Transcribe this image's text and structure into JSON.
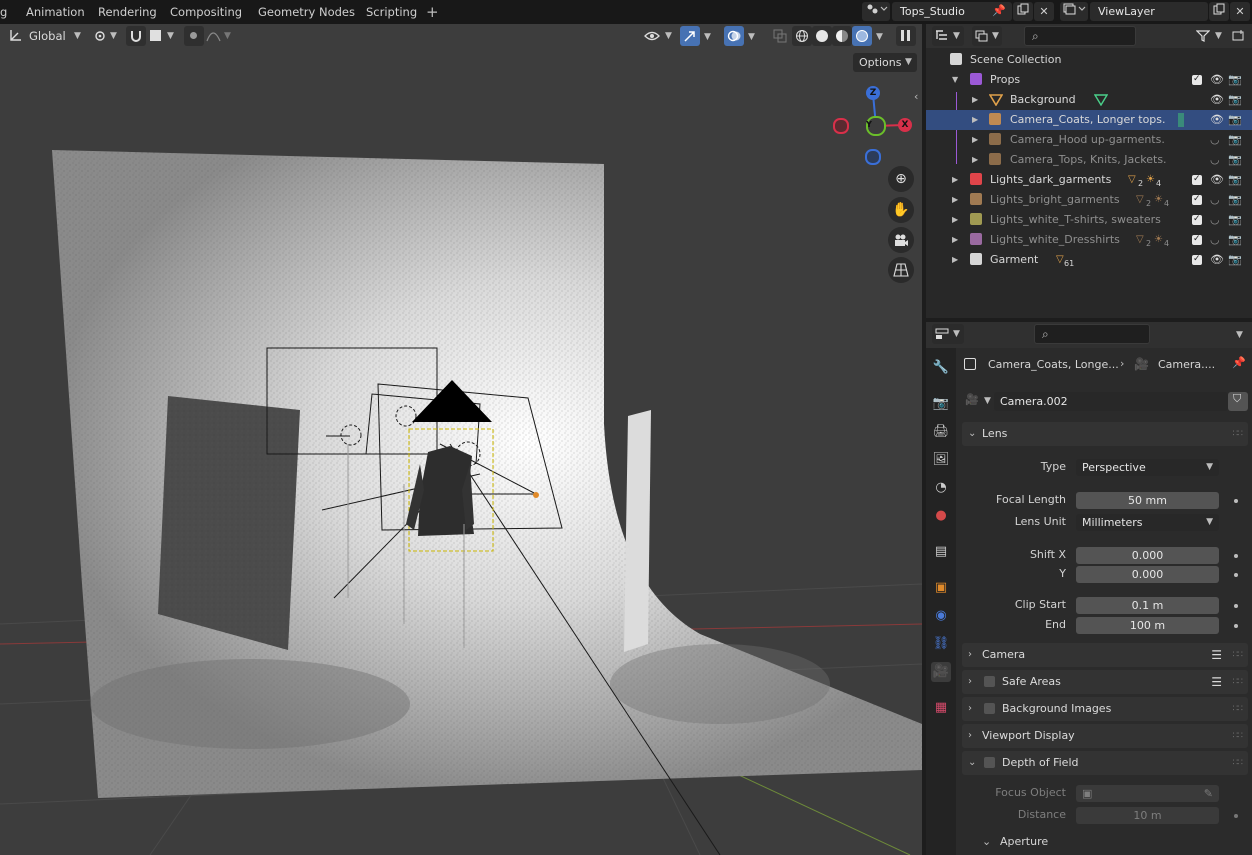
{
  "topbar": {
    "tabs": [
      "g",
      "Animation",
      "Rendering",
      "Compositing",
      "Geometry Nodes",
      "Scripting"
    ],
    "add_tab": "+",
    "scene_name": "Tops_Studio",
    "view_layer": "ViewLayer"
  },
  "viewport": {
    "orientation": "Global",
    "options_label": "Options",
    "gizmo_axes": {
      "z": "Z",
      "y": "Y",
      "x": "X"
    }
  },
  "outliner": {
    "search_placeholder": "",
    "rows": [
      {
        "label": "Scene Collection"
      },
      {
        "label": "Props"
      },
      {
        "label": "Background"
      },
      {
        "label": "Camera_Coats, Longer tops."
      },
      {
        "label": "Camera_Hood up-garments."
      },
      {
        "label": "Camera_Tops, Knits, Jackets."
      },
      {
        "label": "Lights_dark_garments",
        "badge": "2",
        "badge2": "4"
      },
      {
        "label": "Lights_bright_garments",
        "badge": "2",
        "badge2": "4"
      },
      {
        "label": "Lights_white_T-shirts, sweaters"
      },
      {
        "label": "Lights_white_Dresshirts",
        "badge": "2",
        "badge2": "4"
      },
      {
        "label": "Garment",
        "badge": "61"
      }
    ]
  },
  "properties": {
    "breadcrumb": {
      "object": "Camera_Coats, Longe...",
      "data": "Camera...."
    },
    "datablock": "Camera.002",
    "lens_panel": "Lens",
    "type_label": "Type",
    "type_value": "Perspective",
    "focal_label": "Focal Length",
    "focal_value": "50 mm",
    "lensunit_label": "Lens Unit",
    "lensunit_value": "Millimeters",
    "shiftx_label": "Shift X",
    "shiftx_value": "0.000",
    "shifty_label": "Y",
    "shifty_value": "0.000",
    "clipstart_label": "Clip Start",
    "clipstart_value": "0.1 m",
    "clipend_label": "End",
    "clipend_value": "100 m",
    "panels": {
      "camera": "Camera",
      "safe_areas": "Safe Areas",
      "background_images": "Background Images",
      "viewport_display": "Viewport Display",
      "dof": "Depth of Field",
      "aperture": "Aperture"
    },
    "focus_object_label": "Focus Object",
    "distance_label": "Distance",
    "distance_value": "10 m"
  }
}
